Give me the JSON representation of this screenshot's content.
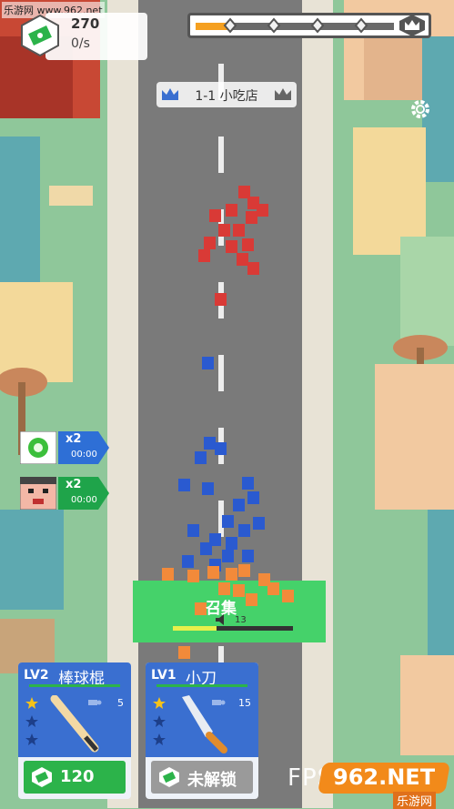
{
  "watermark_top": "乐游网 www.962.net",
  "watermark_bottom": {
    "logo": "962.NET",
    "sub": "乐游网"
  },
  "hud": {
    "money": "270",
    "rate": "0/s",
    "progress": 0.18,
    "stage_label": "1-1 小吃店"
  },
  "boosts": [
    {
      "icon": "green-gear-icon",
      "mult": "x2",
      "time": "00:00",
      "color": "#2e6fd6"
    },
    {
      "icon": "angry-face-icon",
      "mult": "x2",
      "time": "00:00",
      "color": "#1fa44a"
    }
  ],
  "army": {
    "label": "召集",
    "count": "13"
  },
  "cards": [
    {
      "level": "LV2",
      "name": "棒球棍",
      "count": "5",
      "button": "120",
      "button_color": "#2cb34a",
      "icon": "bat-icon"
    },
    {
      "level": "LV1",
      "name": "小刀",
      "count": "15",
      "button": "未解锁",
      "button_color": "#9a9a9a",
      "icon": "knife-icon"
    }
  ],
  "fps": "FPS:60.00",
  "colors": {
    "road": "#7a7a7a",
    "grass": "#8fc79a",
    "red_team": "#d93a36",
    "blue_team": "#2a5ad0"
  }
}
